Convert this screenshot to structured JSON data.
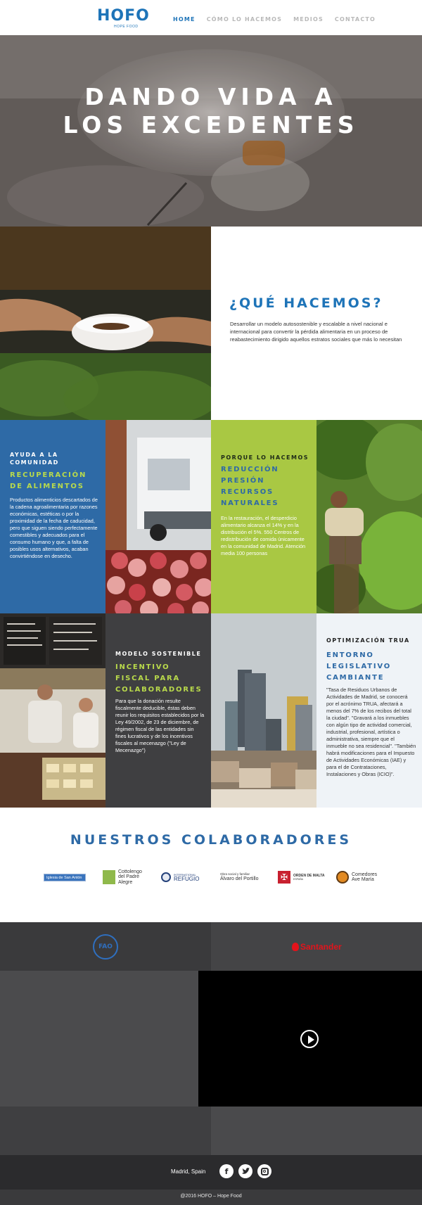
{
  "nav": {
    "logo_text": "HOFO",
    "logo_sub": "HOPE FOOD",
    "links": [
      "HOME",
      "CÓMO LO HACEMOS",
      "MEDIOS",
      "CONTACTO"
    ],
    "active_index": 0,
    "brand_color": "#1e74b8"
  },
  "hero": {
    "title_line1": "DANDO VIDA A",
    "title_line2": "LOS EXCEDENTES"
  },
  "what": {
    "title": "¿QUÉ HACEMOS?",
    "body": "Desarrollar un modelo autosostenible y escalable a nivel nacional e internacional para convertir la pérdida alimentaria en un proceso de reabastecimiento dirigido aquellos estratos sociales que más lo necesitan"
  },
  "tiles": {
    "ayuda": {
      "kicker_line1": "AYUDA A LA",
      "kicker_line2": "COMUNIDAD",
      "head_line1": "RECUPERACIÓN",
      "head_line2": "DE ALIMENTOS",
      "body": "Productos alimenticios descartados de la cadena agroalimentaria por razones económicas, estéticas o por la proximidad de la fecha de caducidad, pero que siguen siendo perfectamente comestibles y adecuados para el consumo humano y que, a falta de posibles usos alternativos, acaban convirtiéndose en desecho."
    },
    "porque": {
      "kicker": "PORQUE LO HACEMOS",
      "head_line1": "REDUCCIÓN",
      "head_line2": "PRESIÓN",
      "head_line3": "RECURSOS",
      "head_line4": "NATURALES",
      "body": "En la restauración, el desperdicio alimentario alcanza el 14% y en la distribución el 5%. 550 Centros de redistribución de comida únicamente en la comunidad de Madrid. Atención media 100 personas"
    },
    "modelo": {
      "kicker": "MODELO SOSTENIBLE",
      "head_line1": "INCENTIVO",
      "head_line2": "FISCAL PARA",
      "head_line3": "COLABORADORES",
      "body": "Para que la donación resulte fiscalmente deducible, éstas deben reunir los requisitos establecidos por la Ley 49/2002, de 23 de diciembre, de régimen fiscal de las entidades sin fines lucrativos y de los incentivos fiscales al mecenazgo (\"Ley de Mecenazgo\")"
    },
    "optimizacion": {
      "kicker": "OPTIMIZACIÓN TRUA",
      "head_line1": "ENTORNO",
      "head_line2": "LEGISLATIVO",
      "head_line3": "CAMBIANTE",
      "body": "\"Tasa de Residuos Urbanos de Actividades de Madrid, se conocerá por el acrónimo TRUA, afectará a menos del 7% de los recibos del total la ciudad\". \"Gravará a los inmuebles con algún tipo de actividad comercial, industrial, profesional, artística o administrativa, siempre que el inmueble no sea residencial\". \"También habrá modificaciones para el Impuesto de Actividades Económicas (IAE) y para el de Contrataciones, Instalaciones y Obras (ICIO)\"."
    }
  },
  "collaborators": {
    "title": "NUESTROS COLABORADORES",
    "partners": [
      {
        "name": "Iglesia de San Antón",
        "icon": "church-logo"
      },
      {
        "name_line1": "Cottolengo",
        "name_line2": "del Padre",
        "name_line3": "Alegre",
        "icon": "cottolengo-logo"
      },
      {
        "name_line1": "INTERNATIONAL",
        "name_line2": "REFUGIO",
        "icon": "refugio-logo"
      },
      {
        "name_line1": "Obra social y familiar",
        "name_line2": "Álvaro del Portillo",
        "icon": "portillo-logo"
      },
      {
        "name_line1": "ORDEN DE MALTA",
        "name_line2": "ESPAÑA",
        "icon": "malta-cross-logo"
      },
      {
        "name_line1": "Comedores",
        "name_line2": "Ave María",
        "icon": "ave-maria-logo"
      }
    ]
  },
  "sponsors": {
    "fao": "FAO",
    "santander": "Santander"
  },
  "footer": {
    "city": "Madrid, Spain",
    "social": [
      "facebook-icon",
      "twitter-icon",
      "instagram-icon"
    ],
    "copyright": "@2016 HOFO – Hope Food"
  }
}
